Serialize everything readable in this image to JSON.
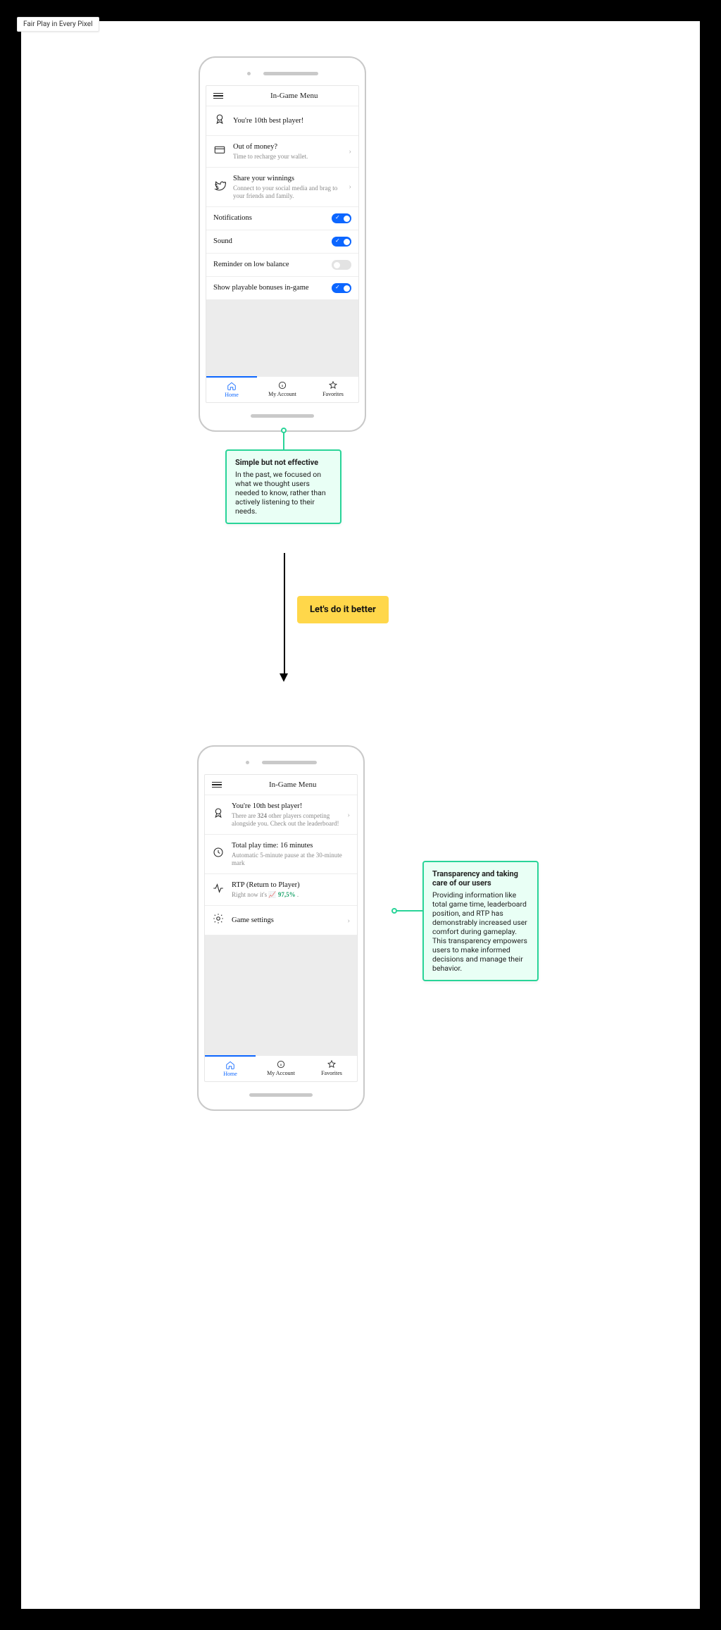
{
  "tag": "Fair Play in Every Pixel",
  "phone1": {
    "title": "In-Game Menu",
    "rank_row": {
      "title": "You're 10th best player!"
    },
    "money_row": {
      "title": "Out of money?",
      "sub": "Time to recharge your wallet."
    },
    "share_row": {
      "title": "Share your winnings",
      "sub": "Connect to your social media and brag to your friends and family."
    },
    "toggles": {
      "notifications": "Notifications",
      "sound": "Sound",
      "reminder": "Reminder on low balance",
      "bonuses": "Show playable bonuses in-game"
    },
    "tabs": {
      "home": "Home",
      "account": "My Account",
      "favorites": "Favorites"
    }
  },
  "callout1": {
    "title": "Simple but not effective",
    "body": "In the past, we focused on what we thought users needed to know, rather than actively listening to their needs."
  },
  "cta": "Let's do it better",
  "phone2": {
    "title": "In-Game Menu",
    "rank_row": {
      "title": "You're 10th best player!",
      "sub_a": "There are ",
      "sub_b": "324",
      "sub_c": " other players competing alongside you. Check out the leaderboard!"
    },
    "time_row": {
      "title": "Total play time: 16 minutes",
      "sub": "Automatic 5-minute pause at the 30-minute mark"
    },
    "rtp_row": {
      "title": "RTP (Return to Player)",
      "sub_a": "Right now it's ",
      "val": "97,5%",
      "sub_b": " ."
    },
    "settings_row": {
      "title": "Game settings"
    },
    "tabs": {
      "home": "Home",
      "account": "My Account",
      "favorites": "Favorites"
    }
  },
  "callout2": {
    "title": "Transparency and taking care of our users",
    "body": "Providing information like total game time, leaderboard position, and RTP has demonstrably increased user comfort during gameplay. This transparency empowers users to make informed decisions and manage their behavior."
  }
}
